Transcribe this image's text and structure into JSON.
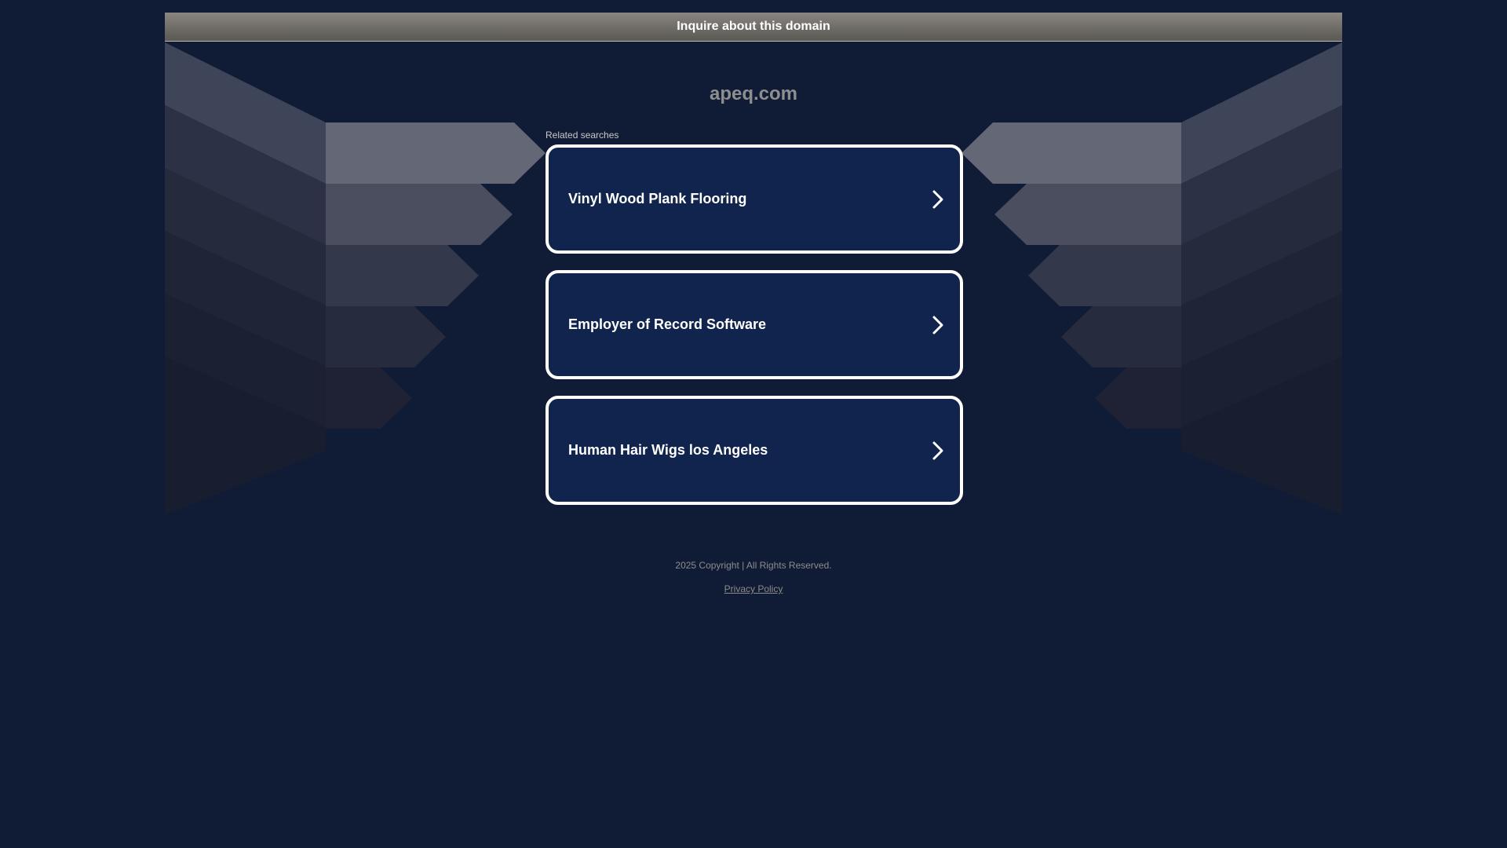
{
  "inquire": {
    "label": "Inquire about this domain"
  },
  "domain": {
    "name": "apeq.com"
  },
  "related": {
    "label": "Related searches",
    "items": [
      {
        "label": "Vinyl Wood Plank Flooring"
      },
      {
        "label": "Employer of Record Software"
      },
      {
        "label": "Human Hair Wigs los Angeles"
      }
    ]
  },
  "footer": {
    "copyright": "2025 Copyright | All Rights Reserved.",
    "privacy": "Privacy Policy"
  },
  "colors": {
    "background": "#101c36",
    "card_background": "#11244d",
    "card_border": "#ffffff",
    "bar_top": "#8a8782",
    "bar_bottom": "#5b5954"
  },
  "icons": {
    "card_arrow": "chevron-right-icon"
  }
}
